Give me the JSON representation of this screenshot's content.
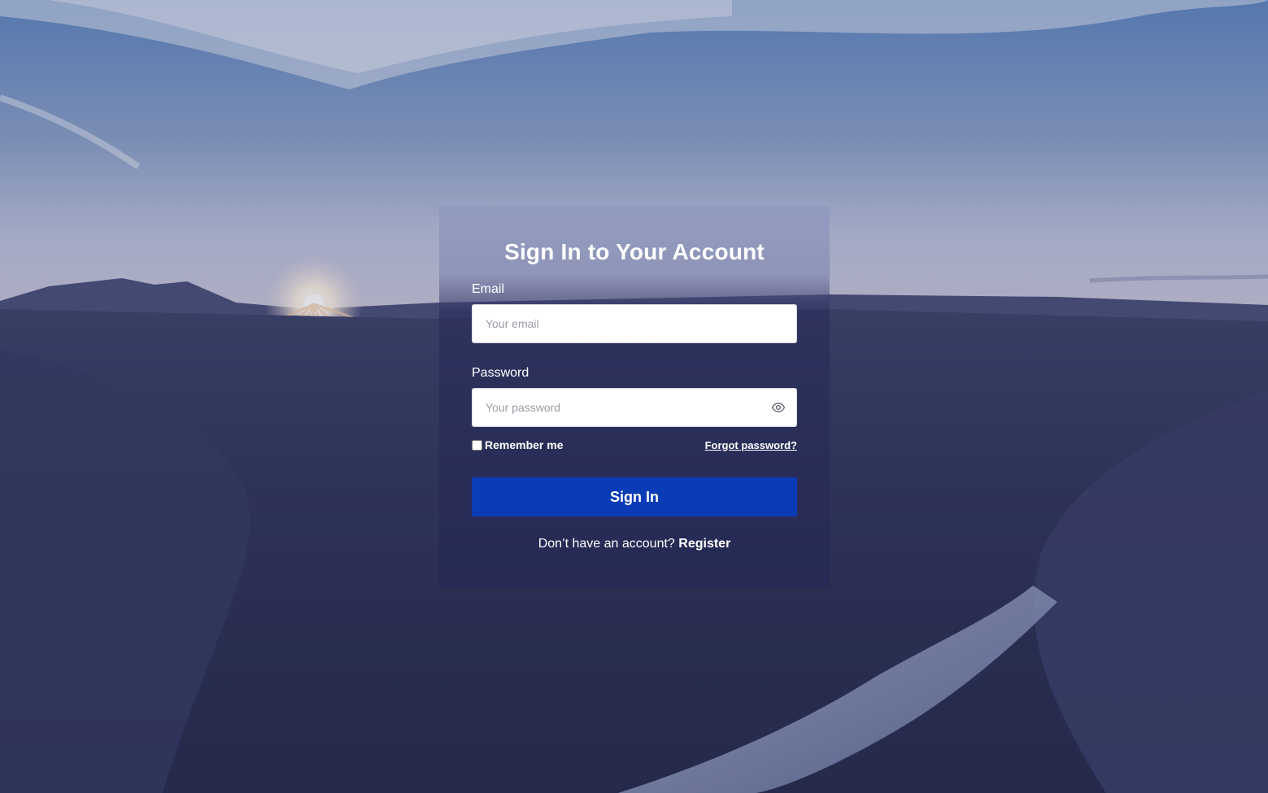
{
  "form": {
    "title": "Sign In to Your Account",
    "email_label": "Email",
    "email_placeholder": "Your email",
    "email_value": "",
    "password_label": "Password",
    "password_placeholder": "Your password",
    "password_value": "",
    "remember_label": "Remember me",
    "remember_checked": false,
    "forgot_label": "Forgot password?",
    "submit_label": "Sign In",
    "register_prompt": "Don’t have an account?",
    "register_link": "Register"
  },
  "icons": {
    "password_toggle": "eye-icon"
  },
  "colors": {
    "primary_button": "#0a3cb7",
    "text": "#ffffff"
  }
}
